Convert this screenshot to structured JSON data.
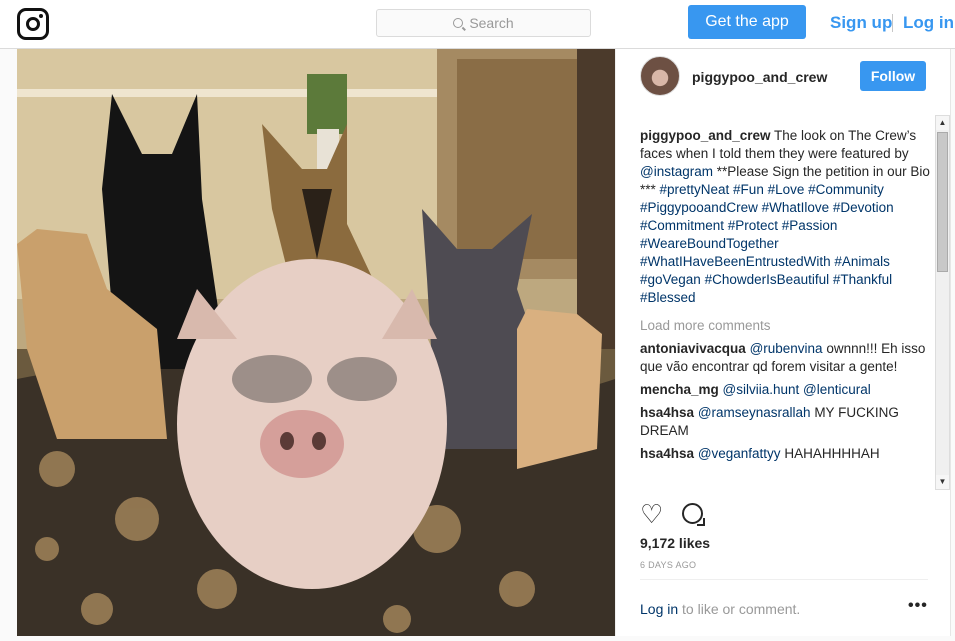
{
  "topbar": {
    "logo_icon": "instagram-camera-icon",
    "search_placeholder": "Search",
    "get_app_label": "Get the app",
    "signup_label": "Sign up",
    "login_label": "Log in"
  },
  "post": {
    "username": "piggypoo_and_crew",
    "follow_label": "Follow",
    "caption": {
      "author": "piggypoo_and_crew",
      "text_parts": [
        {
          "text": " The look on The Crew’s faces when I told them they were featured by ",
          "type": "text"
        },
        {
          "text": "@instagram",
          "type": "tag"
        },
        {
          "text": " **Please Sign the petition in our Bio *** ",
          "type": "text"
        },
        {
          "text": "#prettyNeat #Fun #Love #Community #PiggypooandCrew #WhatIlove #Devotion #Commitment #Protect #Passion #WeareBoundTogether #WhatIHaveBeenEntrustedWith #Animals #goVegan #ChowderIsBeautiful #Thankful #Blessed",
          "type": "tag"
        }
      ]
    },
    "load_more": "Load more comments",
    "comments": [
      {
        "user": "antoniavivacqua",
        "mention": "@rubenvina",
        "text": " ownnn!!! Eh isso que vão encontrar qd forem visitar a gente!"
      },
      {
        "user": "mencha_mg",
        "mention": "@silviia.hunt @lenticural",
        "text": ""
      },
      {
        "user": "hsa4hsa",
        "mention": "@ramseynasrallah",
        "text": " MY FUCKING DREAM"
      },
      {
        "user": "hsa4hsa",
        "mention": "@veganfattyy",
        "text": " HAHAHHHHAH"
      }
    ],
    "likes": "9,172 likes",
    "time_ago": "6 DAYS AGO",
    "footer_login": "Log in",
    "footer_text": " to like or comment.",
    "more_options": "•••"
  }
}
